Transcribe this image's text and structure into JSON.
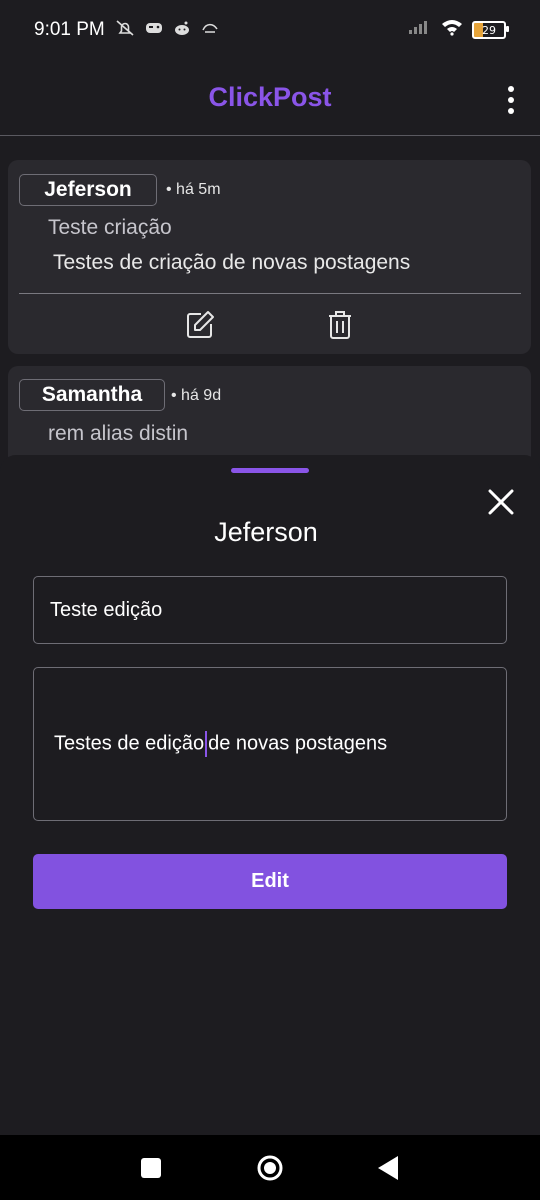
{
  "status_bar": {
    "time": "9:01 PM",
    "battery": "29",
    "left_icons": [
      "mute-icon",
      "game-icon",
      "reddit-icon",
      "app-icon"
    ],
    "right_icons": [
      "signal-icon",
      "wifi-icon",
      "battery-icon"
    ]
  },
  "app_bar": {
    "title": "ClickPost",
    "menu_icon": "more-vert-icon"
  },
  "posts": [
    {
      "author": "Jeferson",
      "time": "• há 5m",
      "title": "Teste criação",
      "body": "Testes de criação de novas postagens",
      "actions": [
        "edit-icon",
        "delete-icon"
      ]
    },
    {
      "author": "Samantha",
      "time": "• há 9d",
      "title": "rem alias distin",
      "body": ""
    }
  ],
  "edit_sheet": {
    "title": "Jeferson",
    "title_value": "Teste edição",
    "body_value_before_cursor": "Testes de edição",
    "body_value_after_cursor": "de novas postagens",
    "submit_label": "Edit",
    "close_icon": "close-icon"
  },
  "colors": {
    "accent": "#8252e0",
    "background": "#1d1c20",
    "card": "#2a292e",
    "title": "#8a55e8"
  },
  "nav_bar": {
    "icons": [
      "recents-icon",
      "home-icon",
      "back-icon"
    ]
  }
}
